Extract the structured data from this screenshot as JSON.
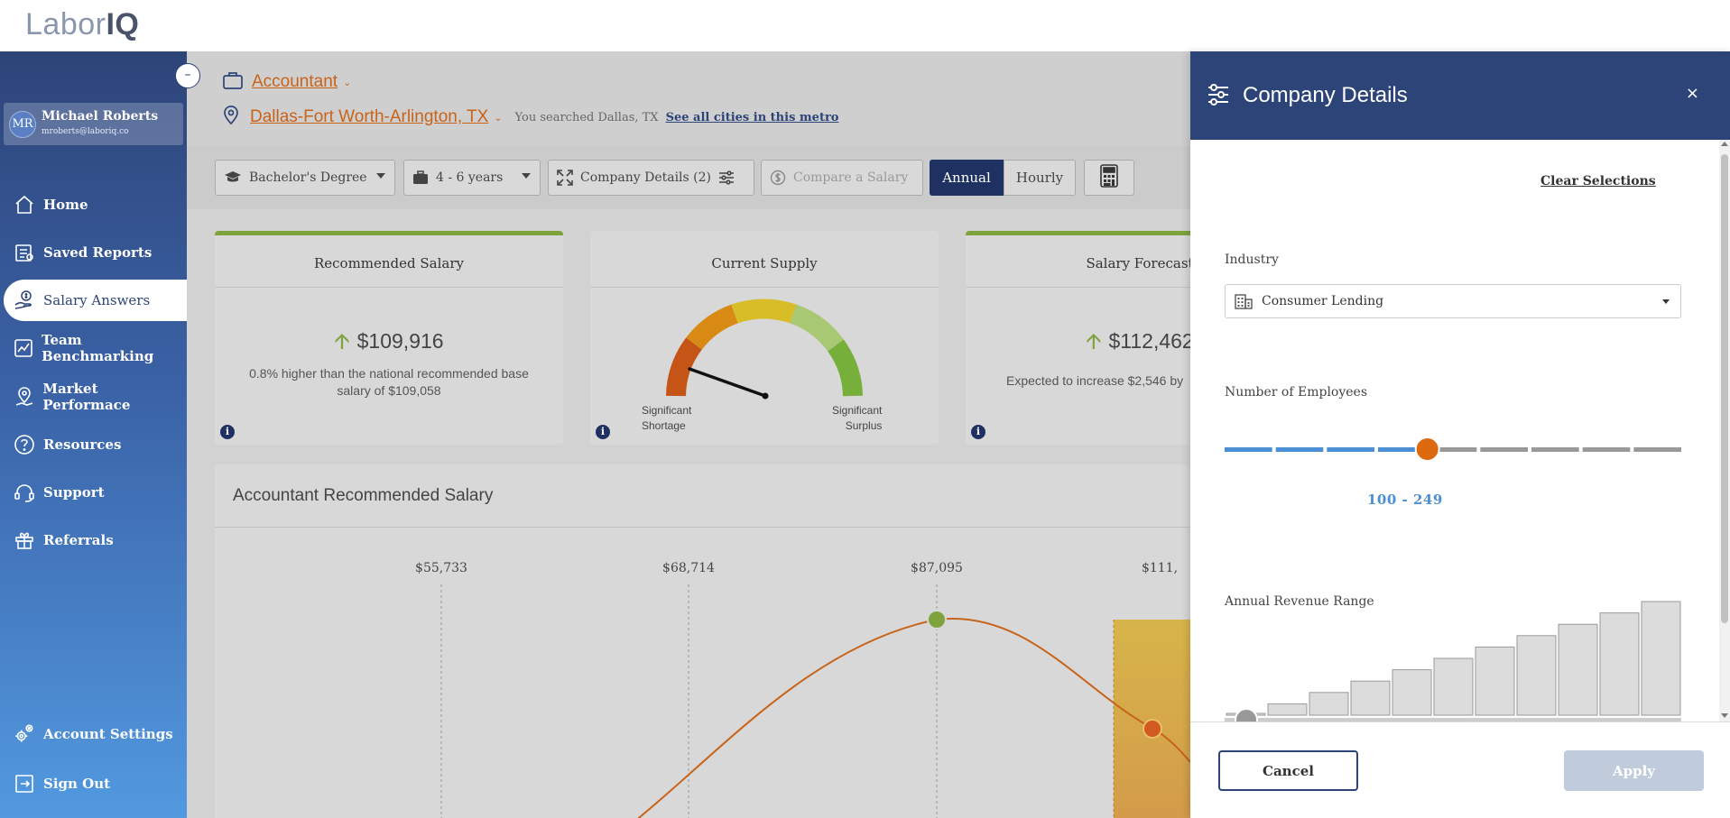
{
  "app": {
    "logo_primary": "Labor",
    "logo_secondary": "IQ"
  },
  "sidebar": {
    "collapse_glyph": "–",
    "user": {
      "initials": "MR",
      "name": "Michael Roberts",
      "email": "mroberts@laboriq.co"
    },
    "items": [
      {
        "label": "Home",
        "icon": "home-icon"
      },
      {
        "label": "Saved Reports",
        "icon": "saved-reports-icon"
      },
      {
        "label": "Salary Answers",
        "icon": "salary-answers-icon",
        "active": true
      },
      {
        "label": "Team Benchmarking",
        "icon": "team-benchmarking-icon"
      },
      {
        "label": "Market Performace",
        "icon": "market-performance-icon"
      },
      {
        "label": "Resources",
        "icon": "resources-icon"
      },
      {
        "label": "Support",
        "icon": "support-icon"
      },
      {
        "label": "Referrals",
        "icon": "referrals-icon"
      }
    ],
    "bottom_items": [
      {
        "label": "Account Settings",
        "icon": "account-settings-icon"
      },
      {
        "label": "Sign Out",
        "icon": "sign-out-icon"
      }
    ]
  },
  "header": {
    "job_title": "Accountant",
    "location": "Dallas-Fort Worth-Arlington, TX",
    "searched_text": "You searched Dallas, TX",
    "metro_link": "See all cities in this metro"
  },
  "filters": {
    "education": "Bachelor's Degree",
    "experience": "4 - 6 years",
    "company_details": "Company Details (2)",
    "compare_placeholder": "Compare a Salary",
    "annual": "Annual",
    "hourly": "Hourly"
  },
  "cards": {
    "recommended": {
      "title": "Recommended Salary",
      "value": "$109,916",
      "subtitle": "0.8% higher than the national recommended base salary of $109,058"
    },
    "supply": {
      "title": "Current Supply",
      "left_label_1": "Significant",
      "left_label_2": "Shortage",
      "right_label_1": "Significant",
      "right_label_2": "Surplus"
    },
    "forecast": {
      "title": "Salary Forecast",
      "value": "$112,462",
      "subtitle": "Expected to increase $2,546 by"
    },
    "info_glyph": "i"
  },
  "chart_data": {
    "type": "line",
    "title": "Accountant Recommended Salary",
    "x_markers": [
      "$55,733",
      "$68,714",
      "$87,095",
      "$111,"
    ],
    "peak_marker": "$87,095",
    "current_marker": "$111,"
  },
  "drawer": {
    "title": "Company Details",
    "close_glyph": "×",
    "clear_selections": "Clear Selections",
    "industry_label": "Industry",
    "industry_value": "Consumer Lending",
    "employees_label": "Number of Employees",
    "employees_value": "100 - 249",
    "employees_selected_index": 4,
    "employees_segment_count": 9,
    "revenue_label": "Annual Revenue Range",
    "revenue_bars": [
      0,
      1,
      2,
      3,
      4,
      5,
      6,
      7,
      8,
      9,
      10
    ],
    "cancel": "Cancel",
    "apply": "Apply"
  },
  "colors": {
    "navy": "#2d4478",
    "orange": "#c8631a",
    "green": "#7ea33c",
    "slider_blue": "#4a8fd4"
  }
}
